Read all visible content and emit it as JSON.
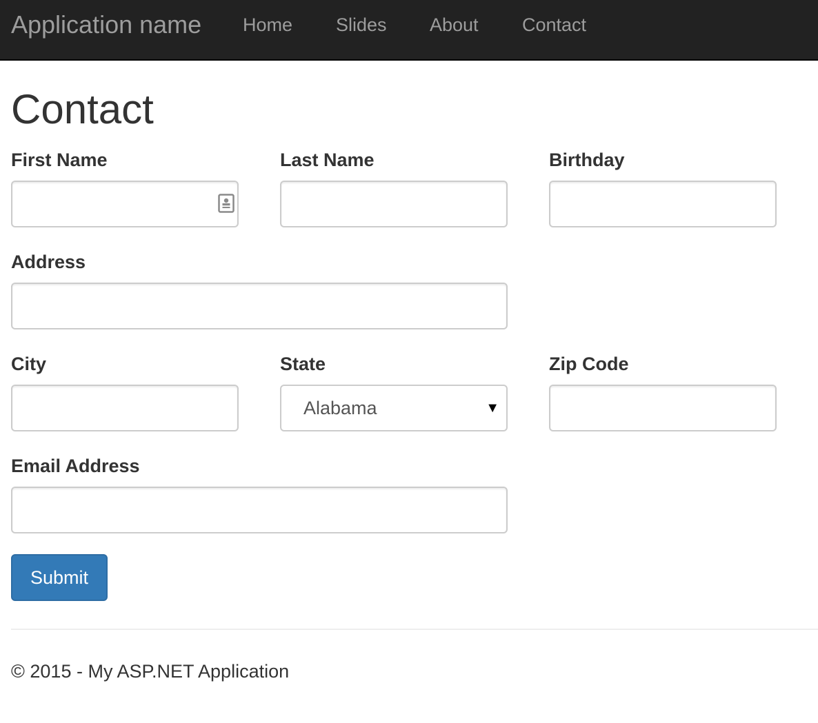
{
  "navbar": {
    "brand": "Application name",
    "links": [
      {
        "label": "Home"
      },
      {
        "label": "Slides"
      },
      {
        "label": "About"
      },
      {
        "label": "Contact"
      }
    ],
    "background": "#222222",
    "text_color": "#9d9d9d"
  },
  "page": {
    "title": "Contact"
  },
  "form": {
    "first_name": {
      "label": "First Name",
      "value": ""
    },
    "last_name": {
      "label": "Last Name",
      "value": ""
    },
    "birthday": {
      "label": "Birthday",
      "value": ""
    },
    "address": {
      "label": "Address",
      "value": ""
    },
    "city": {
      "label": "City",
      "value": ""
    },
    "state": {
      "label": "State",
      "selected": "Alabama"
    },
    "zip_code": {
      "label": "Zip Code",
      "value": ""
    },
    "email": {
      "label": "Email Address",
      "value": ""
    },
    "submit_label": "Submit",
    "submit_color": "#337ab7",
    "autofill_icon": "contact-card-icon"
  },
  "footer": {
    "text": "© 2015 - My ASP.NET Application"
  }
}
